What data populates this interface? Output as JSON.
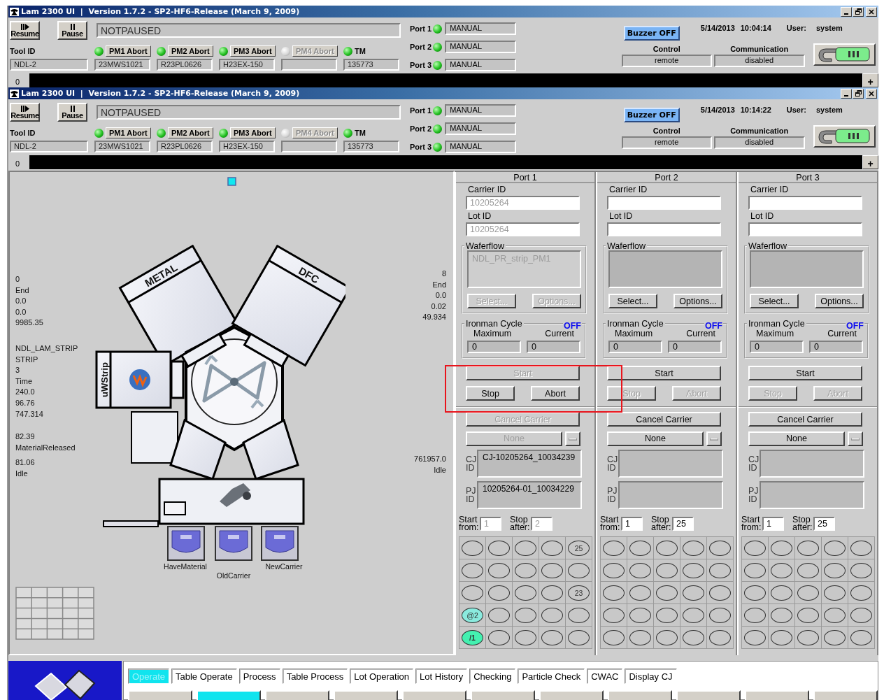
{
  "windows": [
    {
      "title": "Lam 2300 UI  |  Version 1.7.2 - SP2-HF6-Release (March 9, 2009)",
      "actions": [
        {
          "label": "Resume",
          "kind": "resume"
        },
        {
          "label": "Pause",
          "kind": "pause"
        }
      ],
      "status": "NOTPAUSED",
      "tool": {
        "label": "Tool ID",
        "value": "NDL-2"
      },
      "modules": [
        {
          "label": "PM1 Abort",
          "kind": "button",
          "on": true,
          "disabled": false,
          "value": "23MWS1021"
        },
        {
          "label": "PM2 Abort",
          "kind": "button",
          "on": true,
          "disabled": false,
          "value": "R23PL0626"
        },
        {
          "label": "PM3 Abort",
          "kind": "button",
          "on": true,
          "disabled": false,
          "value": "H23EX-150"
        },
        {
          "label": "PM4 Abort",
          "kind": "button",
          "on": false,
          "disabled": true
        },
        {
          "label": "TM",
          "kind": "label",
          "on": true,
          "value": "135773"
        }
      ],
      "load_ports": [
        {
          "label": "Port 1",
          "on": true,
          "mode": "MANUAL"
        },
        {
          "label": "Port 2",
          "on": true,
          "mode": "MANUAL"
        },
        {
          "label": "Port 3",
          "on": true,
          "mode": "MANUAL"
        }
      ],
      "buzzer": "Buzzer OFF",
      "date": "5/14/2013",
      "time": "10:04:14",
      "user_label": "User:",
      "user": "system",
      "control": {
        "label": "Control",
        "value": "remote"
      },
      "communication": {
        "label": "Communication",
        "value": "disabled"
      },
      "message_bar": {
        "count": "0",
        "add": "+"
      }
    },
    {
      "title": "Lam 2300 UI  |  Version 1.7.2 - SP2-HF6-Release (March 9, 2009)",
      "actions": [
        {
          "label": "Resume",
          "kind": "resume"
        },
        {
          "label": "Pause",
          "kind": "pause"
        }
      ],
      "status": "NOTPAUSED",
      "tool": {
        "label": "Tool ID",
        "value": "NDL-2"
      },
      "modules": [
        {
          "label": "PM1 Abort",
          "kind": "button",
          "on": true,
          "disabled": false,
          "value": "23MWS1021"
        },
        {
          "label": "PM2 Abort",
          "kind": "button",
          "on": true,
          "disabled": false,
          "value": "R23PL0626"
        },
        {
          "label": "PM3 Abort",
          "kind": "button",
          "on": true,
          "disabled": false,
          "value": "H23EX-150"
        },
        {
          "label": "PM4 Abort",
          "kind": "button",
          "on": false,
          "disabled": true
        },
        {
          "label": "TM",
          "kind": "label",
          "on": true,
          "value": "135773"
        }
      ],
      "load_ports": [
        {
          "label": "Port 1",
          "on": true,
          "mode": "MANUAL"
        },
        {
          "label": "Port 2",
          "on": true,
          "mode": "MANUAL"
        },
        {
          "label": "Port 3",
          "on": true,
          "mode": "MANUAL"
        }
      ],
      "buzzer": "Buzzer OFF",
      "date": "5/14/2013",
      "time": "10:14:22",
      "user_label": "User:",
      "user": "system",
      "control": {
        "label": "Control",
        "value": "remote"
      },
      "communication": {
        "label": "Communication",
        "value": "disabled"
      },
      "message_bar": {
        "count": "0",
        "add": "+"
      }
    }
  ],
  "process_view": {
    "chambers": [
      {
        "label": "METAL"
      },
      {
        "label": "DFC"
      },
      {
        "label": "uWStrip"
      }
    ],
    "carriers": [
      {
        "label": "HaveMaterial"
      },
      {
        "label": "OldCarrier"
      },
      {
        "label": "NewCarrier"
      }
    ],
    "left_readouts": [
      [
        "0",
        "End",
        "0.0",
        "0.0",
        "9985.35"
      ],
      [
        "NDL_LAM_STRIP",
        "STRIP",
        "3",
        "Time",
        "240.0",
        "96.76",
        "747.314"
      ],
      [
        "82.39",
        "MaterialReleased"
      ],
      [
        "81.06",
        "Idle"
      ]
    ],
    "right_readouts": [
      [
        "8",
        "End",
        "0.0",
        "0.02",
        "49.934"
      ],
      [
        "761957.0",
        "Idle"
      ]
    ]
  },
  "ports": [
    {
      "label": "Port 1",
      "highlighted": true,
      "carrier_id": {
        "label": "Carrier ID",
        "value": "10205264",
        "disabled": true
      },
      "lot_id": {
        "label": "Lot ID",
        "value": "10205264",
        "disabled": true
      },
      "waferflow": {
        "label": "Waferflow",
        "value": "NDL_PR_strip_PM1",
        "disabled": true
      },
      "select": {
        "label": "Select...",
        "disabled": true
      },
      "options": {
        "label": "Options...",
        "disabled": true
      },
      "ironman": {
        "label": "Ironman Cycle",
        "status": "OFF",
        "maximum_label": "Maximum",
        "current_label": "Current",
        "maximum": "0",
        "current": "0"
      },
      "start": {
        "label": "Start",
        "disabled": true
      },
      "stop": {
        "label": "Stop",
        "disabled": false
      },
      "abort": {
        "label": "Abort",
        "disabled": false
      },
      "cancel": {
        "label": "Cancel Carrier",
        "disabled": true
      },
      "recipe": {
        "value": "None",
        "disabled": true
      },
      "cj": {
        "label": "CJ ID",
        "value": "CJ-10205264_10034239"
      },
      "pj": {
        "label": "PJ ID",
        "value": "10205264-01_10034229"
      },
      "start_from": {
        "label": "Start from:",
        "value": "1",
        "disabled": true
      },
      "stop_after": {
        "label": "Stop after:",
        "value": "2",
        "disabled": true
      },
      "slots": [
        {
          "kind": "empty"
        },
        {
          "kind": "empty"
        },
        {
          "kind": "empty"
        },
        {
          "kind": "empty"
        },
        {
          "kind": "empty",
          "label": "25"
        },
        {
          "kind": "empty"
        },
        {
          "kind": "empty"
        },
        {
          "kind": "empty"
        },
        {
          "kind": "empty"
        },
        {
          "kind": "empty"
        },
        {
          "kind": "empty"
        },
        {
          "kind": "empty"
        },
        {
          "kind": "empty"
        },
        {
          "kind": "empty"
        },
        {
          "kind": "empty",
          "label": "23"
        },
        {
          "kind": "active",
          "label": "@2"
        },
        {
          "kind": "empty"
        },
        {
          "kind": "empty"
        },
        {
          "kind": "empty"
        },
        {
          "kind": "empty"
        },
        {
          "kind": "done",
          "label": "/1"
        },
        {
          "kind": "empty"
        },
        {
          "kind": "empty"
        },
        {
          "kind": "empty"
        },
        {
          "kind": "empty"
        }
      ]
    },
    {
      "label": "Port 2",
      "highlighted": false,
      "carrier_id": {
        "label": "Carrier ID"
      },
      "lot_id": {
        "label": "Lot ID"
      },
      "waferflow": {
        "label": "Waferflow",
        "disabled": false
      },
      "select": {
        "label": "Select...",
        "disabled": false
      },
      "options": {
        "label": "Options...",
        "disabled": false
      },
      "ironman": {
        "label": "Ironman Cycle",
        "status": "OFF",
        "maximum_label": "Maximum",
        "current_label": "Current",
        "maximum": "0",
        "current": "0"
      },
      "start": {
        "label": "Start",
        "disabled": false
      },
      "stop": {
        "label": "Stop",
        "disabled": true
      },
      "abort": {
        "label": "Abort",
        "disabled": true
      },
      "cancel": {
        "label": "Cancel Carrier",
        "disabled": false
      },
      "recipe": {
        "value": "None",
        "disabled": false
      },
      "cj": {
        "label": "CJ ID"
      },
      "pj": {
        "label": "PJ ID"
      },
      "start_from": {
        "label": "Start from:",
        "value": "1",
        "disabled": false
      },
      "stop_after": {
        "label": "Stop after:",
        "value": "25",
        "disabled": false
      },
      "slots": [
        {
          "kind": "empty"
        },
        {
          "kind": "empty"
        },
        {
          "kind": "empty"
        },
        {
          "kind": "empty"
        },
        {
          "kind": "empty"
        },
        {
          "kind": "empty"
        },
        {
          "kind": "empty"
        },
        {
          "kind": "empty"
        },
        {
          "kind": "empty"
        },
        {
          "kind": "empty"
        },
        {
          "kind": "empty"
        },
        {
          "kind": "empty"
        },
        {
          "kind": "empty"
        },
        {
          "kind": "empty"
        },
        {
          "kind": "empty"
        },
        {
          "kind": "empty"
        },
        {
          "kind": "empty"
        },
        {
          "kind": "empty"
        },
        {
          "kind": "empty"
        },
        {
          "kind": "empty"
        },
        {
          "kind": "empty"
        },
        {
          "kind": "empty"
        },
        {
          "kind": "empty"
        },
        {
          "kind": "empty"
        },
        {
          "kind": "empty"
        }
      ]
    },
    {
      "label": "Port 3",
      "highlighted": false,
      "carrier_id": {
        "label": "Carrier ID"
      },
      "lot_id": {
        "label": "Lot ID"
      },
      "waferflow": {
        "label": "Waferflow",
        "disabled": false
      },
      "select": {
        "label": "Select...",
        "disabled": false
      },
      "options": {
        "label": "Options...",
        "disabled": false
      },
      "ironman": {
        "label": "Ironman Cycle",
        "status": "OFF",
        "maximum_label": "Maximum",
        "current_label": "Current",
        "maximum": "0",
        "current": "0"
      },
      "start": {
        "label": "Start",
        "disabled": false
      },
      "stop": {
        "label": "Stop",
        "disabled": true
      },
      "abort": {
        "label": "Abort",
        "disabled": true
      },
      "cancel": {
        "label": "Cancel Carrier",
        "disabled": false
      },
      "recipe": {
        "value": "None",
        "disabled": false
      },
      "cj": {
        "label": "CJ ID"
      },
      "pj": {
        "label": "PJ ID"
      },
      "start_from": {
        "label": "Start from:",
        "value": "1",
        "disabled": false
      },
      "stop_after": {
        "label": "Stop after:",
        "value": "25",
        "disabled": false
      },
      "slots": [
        {
          "kind": "empty"
        },
        {
          "kind": "empty"
        },
        {
          "kind": "empty"
        },
        {
          "kind": "empty"
        },
        {
          "kind": "empty"
        },
        {
          "kind": "empty"
        },
        {
          "kind": "empty"
        },
        {
          "kind": "empty"
        },
        {
          "kind": "empty"
        },
        {
          "kind": "empty"
        },
        {
          "kind": "empty"
        },
        {
          "kind": "empty"
        },
        {
          "kind": "empty"
        },
        {
          "kind": "empty"
        },
        {
          "kind": "empty"
        },
        {
          "kind": "empty"
        },
        {
          "kind": "empty"
        },
        {
          "kind": "empty"
        },
        {
          "kind": "empty"
        },
        {
          "kind": "empty"
        },
        {
          "kind": "empty"
        },
        {
          "kind": "empty"
        },
        {
          "kind": "empty"
        },
        {
          "kind": "empty"
        },
        {
          "kind": "empty"
        }
      ]
    }
  ],
  "nav": {
    "tabs": [
      {
        "label": "Operate",
        "selected": true
      },
      {
        "label": "Table Operate",
        "selected": false
      },
      {
        "label": "Process",
        "selected": false
      },
      {
        "label": "Table Process",
        "selected": false
      },
      {
        "label": "Lot Operation",
        "selected": false
      },
      {
        "label": "Lot History",
        "selected": false
      },
      {
        "label": "Checking",
        "selected": false
      },
      {
        "label": "Particle Check",
        "selected": false
      },
      {
        "label": "CWAC",
        "selected": false
      },
      {
        "label": "Display CJ",
        "selected": false
      }
    ],
    "buttons": [
      {
        "selected": false
      },
      {
        "selected": true
      },
      {
        "selected": false
      },
      {
        "selected": false
      },
      {
        "selected": false
      },
      {
        "selected": false
      },
      {
        "selected": false
      },
      {
        "selected": false
      },
      {
        "selected": false
      },
      {
        "selected": false
      },
      {
        "selected": false
      }
    ]
  }
}
